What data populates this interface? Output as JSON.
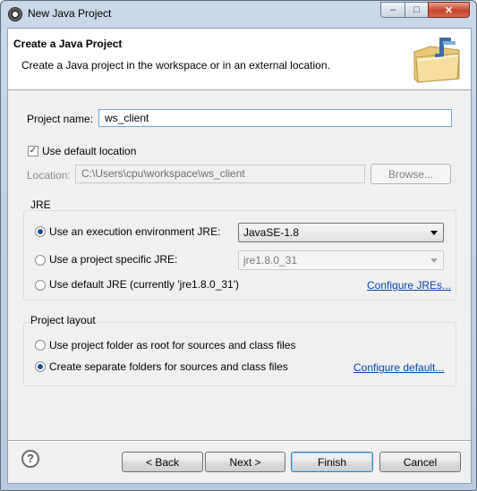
{
  "window": {
    "title": "New Java Project",
    "controls": {
      "minimize": "–",
      "maximize": "□",
      "close": "✕"
    }
  },
  "header": {
    "title": "Create a Java Project",
    "subtitle": "Create a Java project in the workspace or in an external location.",
    "icon": "java-project-folder-icon"
  },
  "project_name": {
    "label": "Project name:",
    "value": "ws_client"
  },
  "default_location": {
    "label": "Use default location",
    "checked": true
  },
  "location": {
    "label": "Location:",
    "value": "C:\\Users\\cpu\\workspace\\ws_client",
    "browse_label": "Browse..."
  },
  "jre": {
    "title": "JRE",
    "option_env": {
      "label": "Use an execution environment JRE:",
      "selected": true,
      "value": "JavaSE-1.8"
    },
    "option_specific": {
      "label": "Use a project specific JRE:",
      "selected": false,
      "value": "jre1.8.0_31"
    },
    "option_default": {
      "label": "Use default JRE (currently 'jre1.8.0_31')",
      "selected": false
    },
    "configure_link": "Configure JREs..."
  },
  "layout": {
    "title": "Project layout",
    "option_root": {
      "label": "Use project folder as root for sources and class files",
      "selected": false
    },
    "option_separate": {
      "label": "Create separate folders for sources and class files",
      "selected": true
    },
    "configure_link": "Configure default..."
  },
  "footer": {
    "help_icon": "?",
    "back_label": "< Back",
    "next_label": "Next >",
    "finish_label": "Finish",
    "cancel_label": "Cancel"
  }
}
